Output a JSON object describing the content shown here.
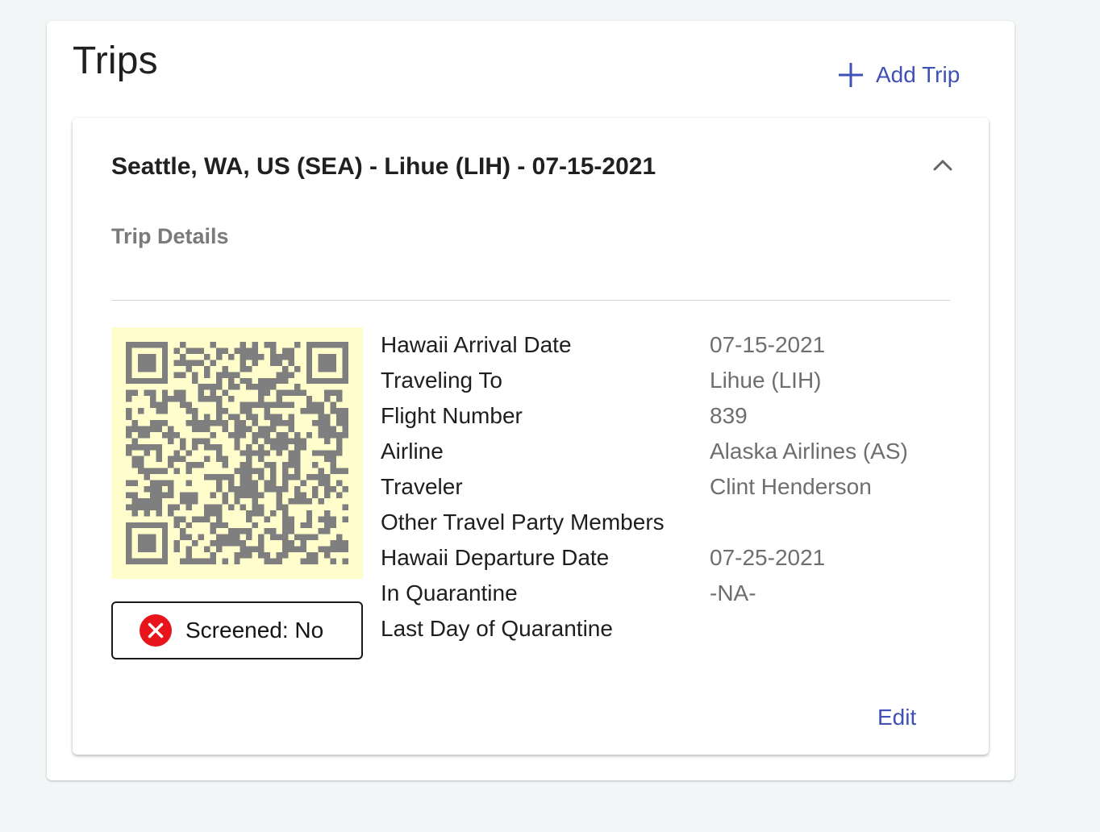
{
  "page": {
    "title": "Trips",
    "add_trip_label": "Add Trip"
  },
  "trip": {
    "header": "Seattle, WA, US (SEA) - Lihue (LIH) - 07-15-2021",
    "section_title": "Trip Details",
    "screened_label": "Screened: No",
    "edit_label": "Edit",
    "details": [
      {
        "label": "Hawaii Arrival Date",
        "value": "07-15-2021"
      },
      {
        "label": "Traveling To",
        "value": "Lihue (LIH)"
      },
      {
        "label": "Flight Number",
        "value": "839"
      },
      {
        "label": "Airline",
        "value": "Alaska Airlines (AS)"
      },
      {
        "label": "Traveler",
        "value": "Clint Henderson"
      },
      {
        "label": "Other Travel Party Members",
        "value": ""
      },
      {
        "label": "Hawaii Departure Date",
        "value": "07-25-2021"
      },
      {
        "label": "In Quarantine",
        "value": "-NA-"
      },
      {
        "label": "Last Day of Quarantine",
        "value": ""
      }
    ]
  },
  "icons": {
    "add": "plus-icon",
    "collapse": "chevron-up-icon",
    "screened_status": "close-circle-icon",
    "qr": "qr-code-icon"
  },
  "colors": {
    "accent": "#3f51b5",
    "qr_background": "#fffdcc",
    "qr_modules": "#7f7f7f",
    "error": "#e8141c"
  }
}
